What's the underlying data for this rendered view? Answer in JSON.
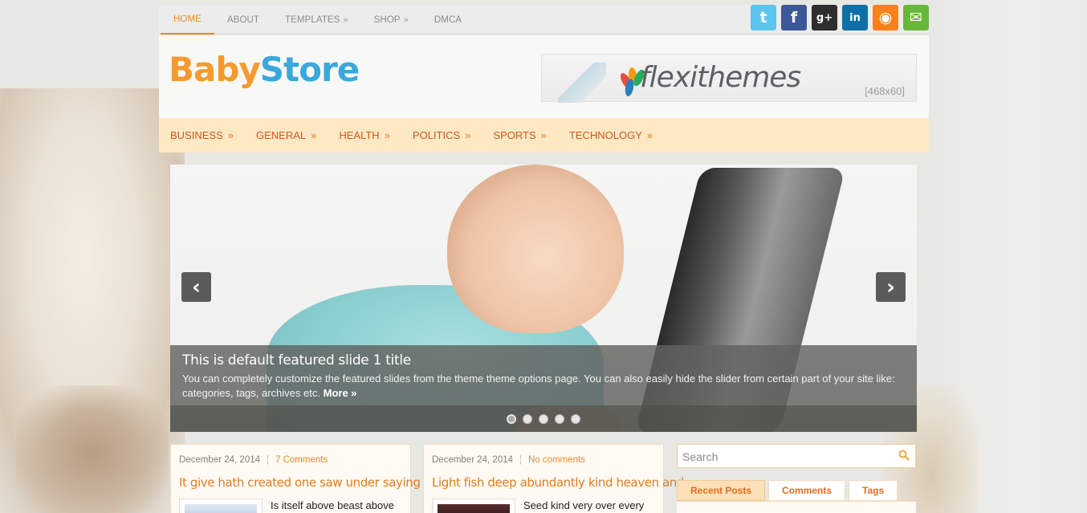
{
  "topnav": {
    "items": [
      {
        "label": "HOME",
        "has_submenu": false,
        "active": true
      },
      {
        "label": "ABOUT",
        "has_submenu": false,
        "active": false
      },
      {
        "label": "TEMPLATES",
        "has_submenu": true,
        "active": false
      },
      {
        "label": "SHOP",
        "has_submenu": true,
        "active": false
      },
      {
        "label": "DMCA",
        "has_submenu": false,
        "active": false
      }
    ],
    "submenu_arrow": "»",
    "accent_color": "#f08a1c"
  },
  "social": [
    {
      "name": "twitter-icon",
      "glyph": "t",
      "color": "#5cc5ef"
    },
    {
      "name": "facebook-icon",
      "glyph": "f",
      "color": "#3b5998"
    },
    {
      "name": "google-plus-icon",
      "glyph": "g+",
      "color": "#2e2e2e"
    },
    {
      "name": "linkedin-icon",
      "glyph": "in",
      "color": "#0f6fa6"
    },
    {
      "name": "rss-icon",
      "glyph": "◉",
      "color": "#f7821b"
    },
    {
      "name": "email-icon",
      "glyph": "✉",
      "color": "#67b83a"
    }
  ],
  "header": {
    "logo_part1": "Baby",
    "logo_part2": "Store",
    "banner_brand": "flexithemes",
    "banner_size": "[468x60]"
  },
  "catnav": {
    "items": [
      "BUSINESS",
      "GENERAL",
      "HEALTH",
      "POLITICS",
      "SPORTS",
      "TECHNOLOGY"
    ],
    "arrow": "»"
  },
  "slider": {
    "title": "This is default featured slide 1 title",
    "description": "You can completely customize the featured slides from the theme theme options page. You can also easily hide the slider from certain part of your site like: categories, tags, archives etc.",
    "more_label": "More »",
    "prev_glyph": "‹",
    "next_glyph": "›",
    "dot_count": 5,
    "active_dot": 0
  },
  "posts": [
    {
      "date": "December 24, 2014",
      "comments": "7 Comments",
      "title": "It give hath created one saw under saying saw",
      "excerpt": "Is itself above beast above"
    },
    {
      "date": "December 24, 2014",
      "comments": "No comments",
      "title": "Light fish deep abundantly kind heaven and",
      "excerpt": "Seed kind very over every"
    }
  ],
  "sidebar": {
    "search_placeholder": "Search",
    "tabs": [
      {
        "label": "Recent Posts",
        "active": true
      },
      {
        "label": "Comments",
        "active": false
      },
      {
        "label": "Tags",
        "active": false
      }
    ]
  }
}
